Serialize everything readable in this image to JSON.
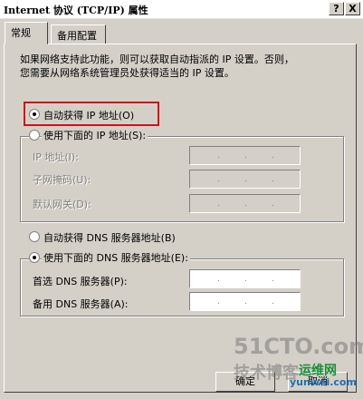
{
  "window": {
    "title": "Internet 协议 (TCP/IP) 属性",
    "help_btn": "?",
    "close_btn": "X"
  },
  "tabs": [
    {
      "label": "常规"
    },
    {
      "label": "备用配置"
    }
  ],
  "intro": {
    "line1": "如果网络支持此功能，则可以获取自动指派的 IP 设置。否则，",
    "line2": "您需要从网络系统管理员处获得适当的 IP 设置。"
  },
  "ip": {
    "auto_label": "自动获得 IP 地址(O)",
    "manual_label": "使用下面的 IP 地址(S):",
    "selected": "auto",
    "fields": [
      {
        "label": "IP 地址(I):"
      },
      {
        "label": "子网掩码(U):"
      },
      {
        "label": "默认网关(D):"
      }
    ]
  },
  "dns": {
    "auto_label": "自动获得 DNS 服务器地址(B)",
    "manual_label": "使用下面的 DNS 服务器地址(E):",
    "selected": "manual",
    "fields": [
      {
        "label": "首选 DNS 服务器(P):"
      },
      {
        "label": "备用 DNS 服务器(A):"
      }
    ]
  },
  "buttons": {
    "ok": "确定",
    "cancel": "取消"
  },
  "watermark": {
    "site": "51CTO.com",
    "tagline": "技术博客",
    "brand": "运维网",
    "url": "yunwei.com"
  },
  "colors": {
    "highlight": "#c8141b",
    "dialog_bg": "#d4d0c8"
  }
}
